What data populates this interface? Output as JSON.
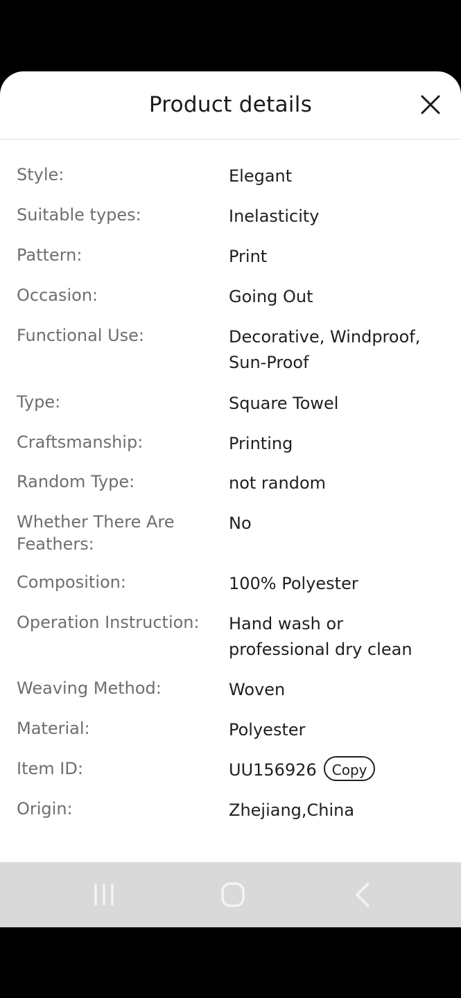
{
  "sheet": {
    "title": "Product details",
    "close_icon": "close-icon"
  },
  "details": [
    {
      "label": "Style:",
      "value": "Elegant"
    },
    {
      "label": "Suitable types:",
      "value": "Inelasticity"
    },
    {
      "label": "Pattern:",
      "value": "Print"
    },
    {
      "label": "Occasion:",
      "value": "Going Out"
    },
    {
      "label": "Functional Use:",
      "value": "Decorative, Windproof, Sun-Proof"
    },
    {
      "label": "Type:",
      "value": "Square Towel"
    },
    {
      "label": "Craftsmanship:",
      "value": "Printing"
    },
    {
      "label": "Random Type:",
      "value": "not random"
    },
    {
      "label": "Whether There Are Feathers:",
      "value": "No"
    },
    {
      "label": "Composition:",
      "value": "100% Polyester"
    },
    {
      "label": "Operation Instruction:",
      "value": "Hand wash or professional dry clean"
    },
    {
      "label": "Weaving Method:",
      "value": "Woven"
    },
    {
      "label": "Material:",
      "value": "Polyester"
    },
    {
      "label": "Item ID:",
      "value": "UU156926",
      "copy_label": "Copy"
    },
    {
      "label": "Origin:",
      "value": "Zhejiang,China"
    }
  ],
  "navbar": {
    "recent_icon": "recent-apps-icon",
    "home_icon": "home-icon",
    "back_icon": "back-icon"
  }
}
